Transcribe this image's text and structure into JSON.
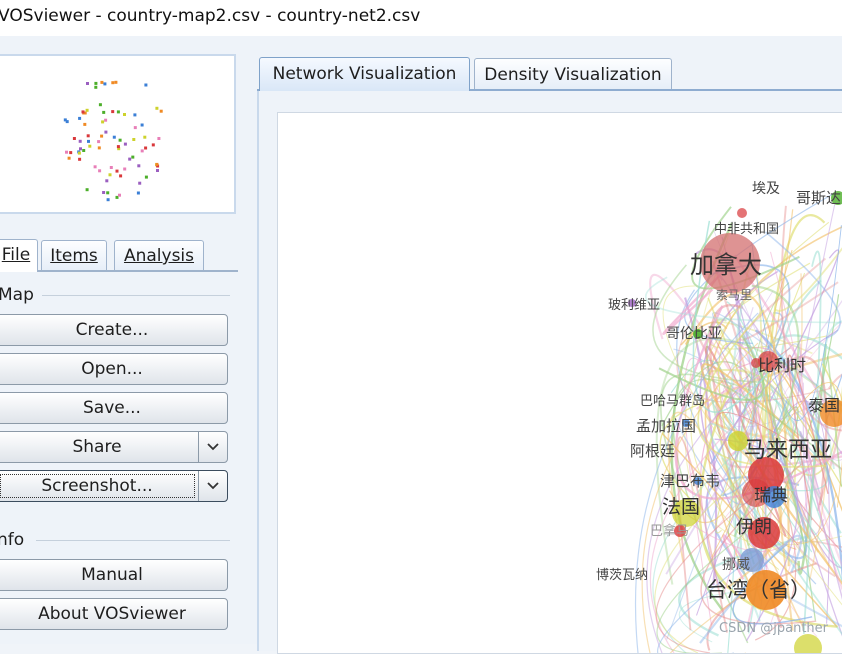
{
  "window": {
    "title": "VOSviewer - country-map2.csv - country-net2.csv"
  },
  "left_panel": {
    "tabs": [
      {
        "label": "File",
        "active": true
      },
      {
        "label": "Items",
        "active": false
      },
      {
        "label": "Analysis",
        "active": false
      }
    ],
    "map_group": {
      "label": "Map",
      "buttons": {
        "create": "Create...",
        "open": "Open...",
        "save": "Save...",
        "share": "Share",
        "screenshot": "Screenshot..."
      }
    },
    "info_group": {
      "label": "Info",
      "buttons": {
        "manual": "Manual",
        "about": "About VOSviewer"
      }
    }
  },
  "visualization_tabs": [
    {
      "label": "Network Visualization",
      "active": true
    },
    {
      "label": "Density Visualization",
      "active": false
    }
  ],
  "network_labels": {
    "egypt": "埃及",
    "costa_rica": "哥斯达",
    "car": "中非共和国",
    "canada": "加拿大",
    "somalia": "索马里",
    "bolivia": "玻利维亚",
    "colombia": "哥伦比亚",
    "belgium": "比利时",
    "thailand": "泰国",
    "bahamas": "巴哈马群岛",
    "bangladesh": "孟加拉国",
    "argentina": "阿根廷",
    "malaysia": "马来西亚",
    "zimbabwe": "津巴布韦",
    "sweden": "瑞典",
    "france": "法国",
    "panama": "巴拿马",
    "iran": "伊朗",
    "norway": "挪威",
    "botswana": "博茨瓦纳",
    "taiwan": "台湾（省）"
  },
  "watermark": "CSDN @jpanther",
  "colors": {
    "accent_tab": "#7fa2c9",
    "cluster_red": "#d9383b",
    "cluster_green": "#4caf2a",
    "cluster_blue": "#3b7fd6",
    "cluster_yellow": "#cdd22c",
    "cluster_orange": "#f08a24",
    "cluster_purple": "#9b5fc0",
    "cluster_pink": "#e87fb8"
  }
}
